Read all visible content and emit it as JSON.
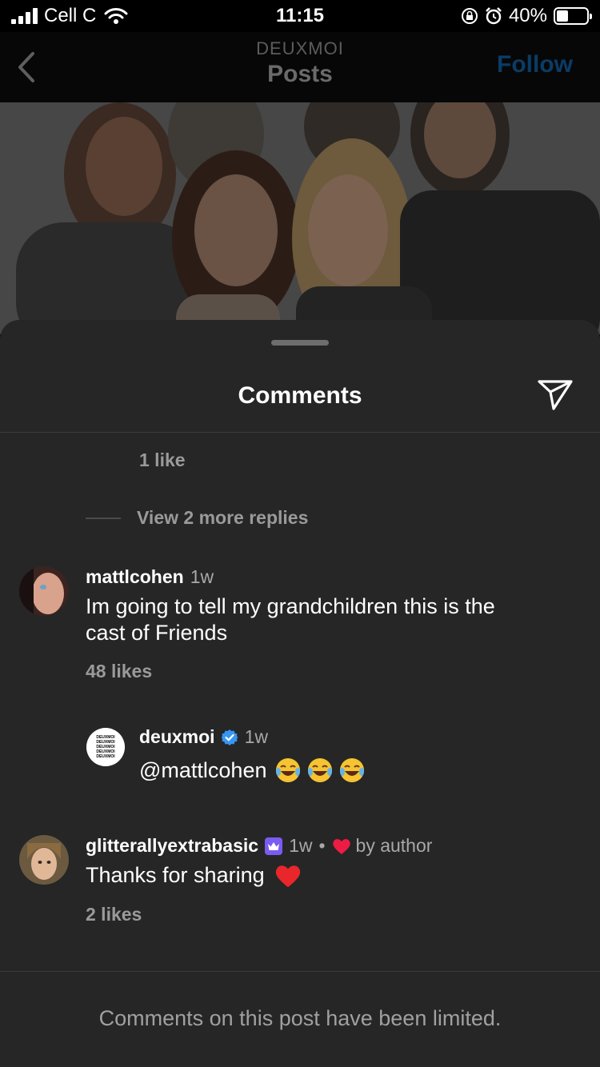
{
  "status_bar": {
    "carrier": "Cell C",
    "time": "11:15",
    "battery_percent": "40%",
    "battery_level": 0.4
  },
  "header": {
    "account": "DEUXMOI",
    "title": "Posts",
    "follow_label": "Follow"
  },
  "sheet": {
    "title": "Comments",
    "previous_likes": "1 like",
    "view_replies": "View 2 more replies",
    "footer_note": "Comments on this post have been limited."
  },
  "comments": [
    {
      "username": "mattlcohen",
      "time": "1w",
      "text": "Im going to tell my grandchildren this is the cast of Friends",
      "likes": "48 likes"
    },
    {
      "username": "deuxmoi",
      "time": "1w",
      "text": "@mattlcohen",
      "verified": true,
      "emoji": [
        "tears-of-joy",
        "tears-of-joy",
        "tears-of-joy"
      ],
      "avatar_logo_text": "DEUXMOI"
    },
    {
      "username": "glitterallyextrabasic",
      "time": "1w",
      "separator": "•",
      "liked_by": "by author",
      "text": "Thanks for sharing",
      "text_emoji": "red-heart",
      "likes": "2 likes"
    }
  ],
  "colors": {
    "sheet_bg": "#262626",
    "follow": "#0a3c66",
    "verified": "#3797f0",
    "heart": "#ed1c45",
    "crown_badge": "#7a5cf0"
  }
}
